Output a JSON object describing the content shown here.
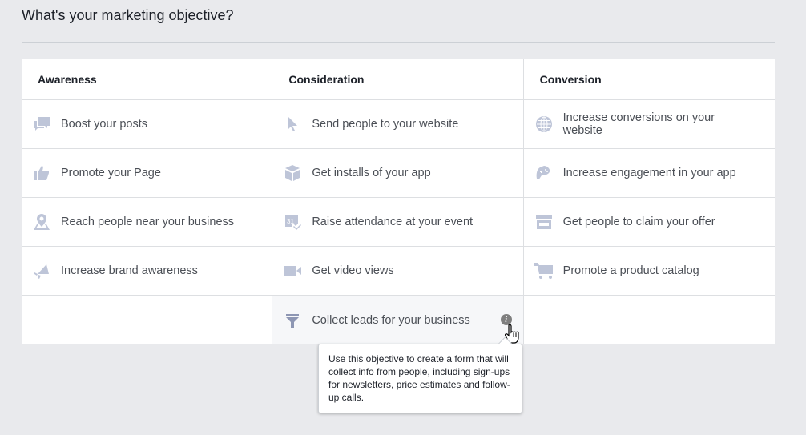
{
  "page": {
    "title": "What's your marketing objective?"
  },
  "columns": [
    {
      "heading": "Awareness",
      "items": [
        {
          "label": "Boost your posts",
          "icon": "chat-bubbles-icon"
        },
        {
          "label": "Promote your Page",
          "icon": "thumbs-up-icon"
        },
        {
          "label": "Reach people near your business",
          "icon": "location-pin-icon"
        },
        {
          "label": "Increase brand awareness",
          "icon": "megaphone-icon"
        }
      ]
    },
    {
      "heading": "Consideration",
      "items": [
        {
          "label": "Send people to your website",
          "icon": "cursor-arrow-icon"
        },
        {
          "label": "Get installs of your app",
          "icon": "cube-icon"
        },
        {
          "label": "Raise attendance at your event",
          "icon": "calendar-icon"
        },
        {
          "label": "Get video views",
          "icon": "video-camera-icon"
        },
        {
          "label": "Collect leads for your business",
          "icon": "funnel-icon",
          "info_icon": "i"
        }
      ]
    },
    {
      "heading": "Conversion",
      "items": [
        {
          "label": "Increase conversions on your website",
          "icon": "globe-icon"
        },
        {
          "label": "Increase engagement in your app",
          "icon": "gamepad-icon"
        },
        {
          "label": "Get people to claim your offer",
          "icon": "storefront-icon"
        },
        {
          "label": "Promote a product catalog",
          "icon": "shopping-cart-icon"
        }
      ]
    }
  ],
  "tooltip": {
    "text": "Use this objective to create a form that will collect info from people, including sign-ups for newsletters, price estimates and follow-up calls."
  },
  "colors": {
    "icon": "#bec5d8",
    "background": "#e9eaed",
    "heading_text": "#1d2129"
  }
}
